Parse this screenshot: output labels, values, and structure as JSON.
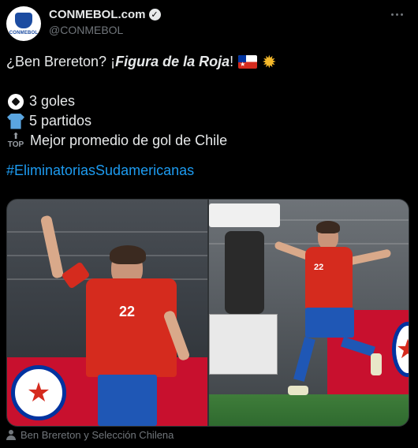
{
  "author": {
    "display_name": "CONMEBOL.com",
    "handle": "@CONMEBOL",
    "avatar_logo_text": "CONMEBOL",
    "verified": true
  },
  "tweet": {
    "line1_prefix": "¿Ben Brereton? ¡",
    "line1_emphasis": "Figura de la Roja",
    "line1_suffix": "!",
    "stats": [
      {
        "icon": "soccer-ball-icon",
        "text": "3 goles"
      },
      {
        "icon": "jersey-icon",
        "text": "5 partidos"
      },
      {
        "icon": "top-arrow-icon",
        "icon_text": "TOP",
        "text": "Mejor promedio de gol de Chile"
      }
    ],
    "hashtag": "#EliminatoriasSudamericanas"
  },
  "media": {
    "photos": [
      {
        "jersey_number": "22",
        "alt": "player celebrating with raised arm"
      },
      {
        "jersey_number": "22",
        "alt": "player celebrating with arms open"
      }
    ]
  },
  "media_tag": "Ben Brereton y Selección Chilena",
  "colors": {
    "background": "#000000",
    "text": "#e7e9ea",
    "secondary": "#71767b",
    "link": "#1d9bf0",
    "chile_red": "#d52b1e",
    "chile_blue": "#1f57b5"
  }
}
